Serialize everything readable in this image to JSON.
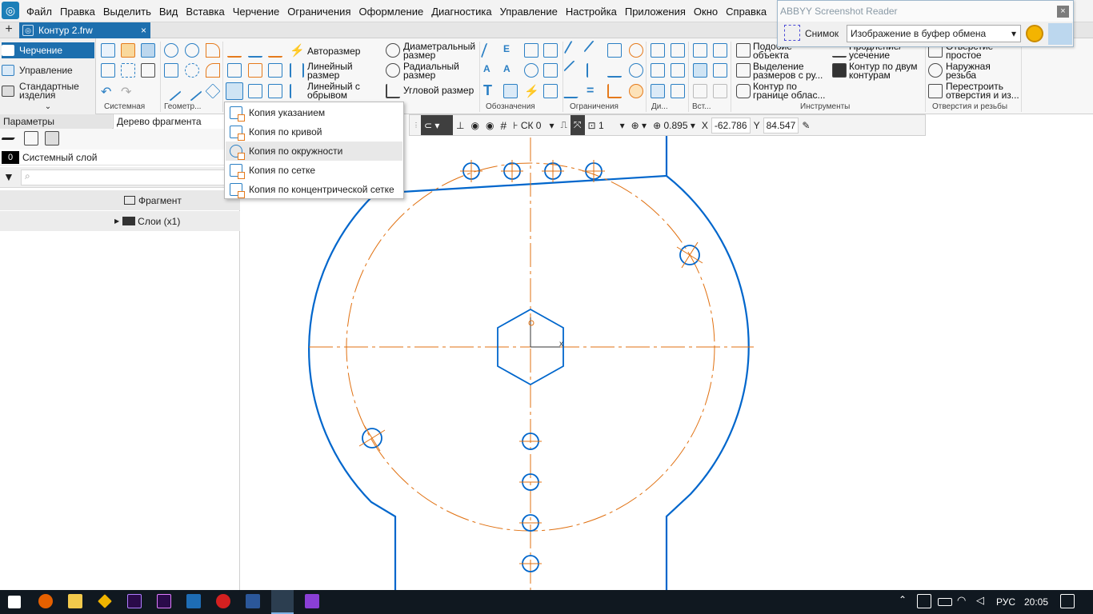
{
  "menubar": {
    "items": [
      "Файл",
      "Правка",
      "Выделить",
      "Вид",
      "Вставка",
      "Черчение",
      "Ограничения",
      "Оформление",
      "Диагностика",
      "Управление",
      "Настройка",
      "Приложения",
      "Окно",
      "Справка"
    ]
  },
  "tabs": {
    "add": "+",
    "doc_title": "Контур 2.frw",
    "close": "×"
  },
  "ribbon": {
    "left": {
      "drawing": "Черчение",
      "management": "Управление",
      "standard": "Стандартные изделия",
      "collapse": "⌄"
    },
    "groups": {
      "system": "Системная",
      "geometry": "Геометр...",
      "marks": "Обозначения",
      "constraints": "Ограничения",
      "di": "Ди...",
      "ins": "Вст...",
      "tools": "Инструменты",
      "holes": "Отверстия и резьбы"
    },
    "dims": {
      "auto": "Авторазмер",
      "linear": "Линейный размер",
      "linear_break": "Линейный с обрывом",
      "diameter": "Диаметральный размер",
      "radial": "Радиальный размер",
      "angular": "Угловой размер"
    },
    "tools": {
      "similar": "Подобие объекта",
      "select_dims": "Выделение размеров с ру...",
      "contour_area": "Контур по границе облас...",
      "extend": "Продление/ усечение",
      "contour_two": "Контур по двум контурам"
    },
    "holes": {
      "simple": "Отверстие простое",
      "thread": "Наружная резьба",
      "rebuild": "Перестроить отверстия и из..."
    }
  },
  "copy_menu": {
    "items": [
      "Копия указанием",
      "Копия по кривой",
      "Копия по окружности",
      "Копия по сетке",
      "Копия по концентрической сетке"
    ],
    "hovered_index": 2
  },
  "left_panel": {
    "tab_params": "Параметры",
    "tab_tree": "Дерево фрагмента",
    "layer_num": "0",
    "layer_name": "Системный слой",
    "search_icon": "⌕",
    "fragment": "Фрагмент",
    "layers": "Слои (x1)"
  },
  "view_toolbar": {
    "cs": "СК 0",
    "step": "1",
    "zoom": "0.895",
    "x_label": "X",
    "x_value": "-62.786",
    "y_label": "Y",
    "y_value": "84.547"
  },
  "abbyy": {
    "title": "ABBYY Screenshot Reader",
    "snapshot_label": "Снимок",
    "mode": "Изображение в буфер обмена",
    "close": "×"
  },
  "taskbar": {
    "lang": "РУС",
    "time": "20:05"
  },
  "colors": {
    "accent": "#1d6fae",
    "geometry": "#0066cc",
    "axis": "#e07010"
  }
}
